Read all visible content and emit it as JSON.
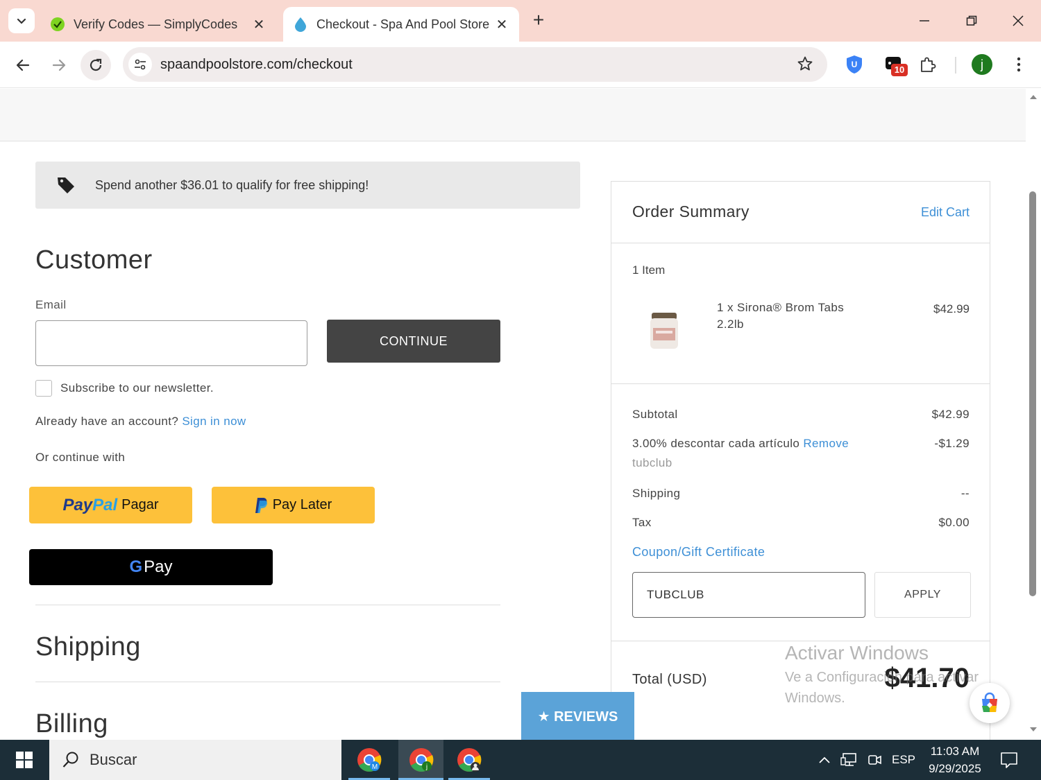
{
  "browser": {
    "tabs": [
      {
        "title": "Verify Codes — SimplyCodes",
        "favicon": "simplycodes-icon",
        "active": false
      },
      {
        "title": "Checkout - Spa And Pool Store",
        "favicon": "water-drop-icon",
        "active": true
      }
    ],
    "url": "spaandpoolstore.com/checkout",
    "extension_badge": "10",
    "profile_initial": "j"
  },
  "page": {
    "shipping_banner": "Spend another $36.01 to qualify for free shipping!",
    "customer": {
      "heading": "Customer",
      "email_label": "Email",
      "email_value": "",
      "continue_label": "CONTINUE",
      "newsletter_label": "Subscribe to our newsletter.",
      "newsletter_checked": false,
      "account_prompt": "Already have an account?",
      "sign_in_label": "Sign in now",
      "or_continue": "Or continue with",
      "paypal_logo": "PayPal",
      "paypal_label": "Pagar",
      "paylater_label": "Pay Later",
      "gpay_label": "Pay"
    },
    "shipping_heading": "Shipping",
    "billing_heading": "Billing",
    "reviews_label": "★ REVIEWS"
  },
  "order_summary": {
    "title": "Order Summary",
    "edit_cart": "Edit Cart",
    "item_count": "1 Item",
    "items": [
      {
        "name": "1 x Sirona® Brom Tabs 2.2lb",
        "price": "$42.99"
      }
    ],
    "subtotal_label": "Subtotal",
    "subtotal_value": "$42.99",
    "discount_label": "3.00% descontar cada artículo",
    "discount_remove": "Remove",
    "discount_code": "tubclub",
    "discount_value": "-$1.29",
    "shipping_label": "Shipping",
    "shipping_value": "--",
    "tax_label": "Tax",
    "tax_value": "$0.00",
    "coupon_link": "Coupon/Gift Certificate",
    "coupon_value": "TUBCLUB",
    "apply_label": "APPLY",
    "total_label": "Total (USD)",
    "total_value": "$41.70"
  },
  "watermark": {
    "line1": "Activar Windows",
    "line2": "Ve a Configuración para activar",
    "line3": "Windows."
  },
  "taskbar": {
    "search_label": "Buscar",
    "language": "ESP",
    "time": "11:03 AM",
    "date": "9/29/2025"
  },
  "colors": {
    "tabbar_bg": "#f9d9d1",
    "link": "#3d8fd6",
    "continue_btn": "#444444",
    "paypal_yellow": "#fdc13a",
    "reviews_tab": "#5ba3d8",
    "taskbar": "#1c2e38"
  }
}
